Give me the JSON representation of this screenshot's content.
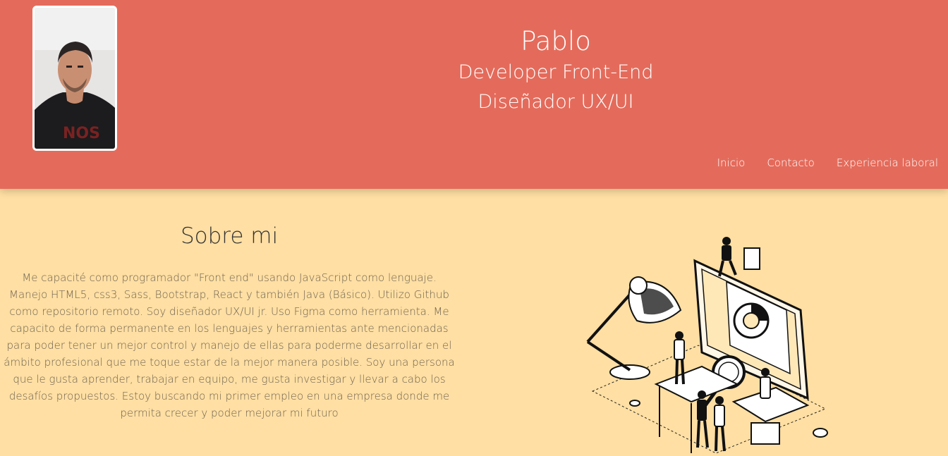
{
  "profile": {
    "name": "Pablo",
    "role_1": "Developer Front-End",
    "role_2": "Diseñador UX/UI"
  },
  "nav": {
    "items": [
      "Inicio",
      "Contacto",
      "Experiencia laboral"
    ]
  },
  "about": {
    "title": "Sobre mi",
    "text": "Me capacité como programador \"Front end\" usando JavaScript como lenguaje. Manejo HTML5, css3, Sass, Bootstrap, React y también Java (Básico). Utilizo Github como repositorio remoto. Soy diseñador UX/UI jr. Uso Figma como herramienta. Me capacito de forma permanente en los lenguajes y herramientas ante mencionadas para poder tener un mejor control y manejo de ellas para poderme desarrollar en el ámbito profesional que me toque estar de la mejor manera posible. Soy una persona que le gusta aprender, trabajar en equipo, me gusta investigar y llevar a cabo los desafíos propuestos. Estoy buscando mi primer empleo en una empresa donde me permita crecer y poder mejorar mi futuro"
  },
  "colors": {
    "header": "#e46b5b",
    "background": "#ffdfa3",
    "text": "#6f6352"
  },
  "icons": {
    "avatar": "profile-photo",
    "illustration": "workspace-isometric-illustration"
  }
}
